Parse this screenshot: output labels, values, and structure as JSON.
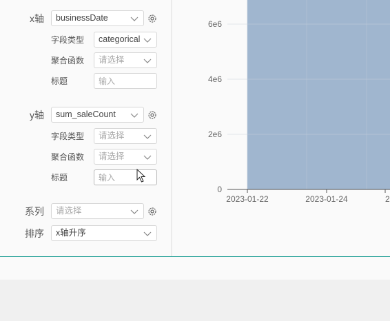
{
  "config": {
    "x_axis": {
      "label": "x轴",
      "field": "businessDate",
      "field_type_label": "字段类型",
      "field_type_value": "categorical",
      "agg_label": "聚合函数",
      "agg_placeholder": "请选择",
      "title_label": "标题",
      "title_placeholder": "输入"
    },
    "y_axis": {
      "label": "y轴",
      "field": "sum_saleCount",
      "field_type_label": "字段类型",
      "field_type_placeholder": "请选择",
      "agg_label": "聚合函数",
      "agg_placeholder": "请选择",
      "title_label": "标题",
      "title_placeholder": "输入"
    },
    "series": {
      "label": "系列",
      "placeholder": "请选择"
    },
    "sort": {
      "label": "排序",
      "value": "x轴升序"
    }
  },
  "chart_data": {
    "type": "bar",
    "y_ticks": [
      "0",
      "2e6",
      "4e6",
      "6e6"
    ],
    "x_ticks": [
      "2023-01-22",
      "2023-01-24",
      "20"
    ],
    "bar_color": "#a0b6cf"
  },
  "colors": {
    "accent": "#2aa39a"
  }
}
